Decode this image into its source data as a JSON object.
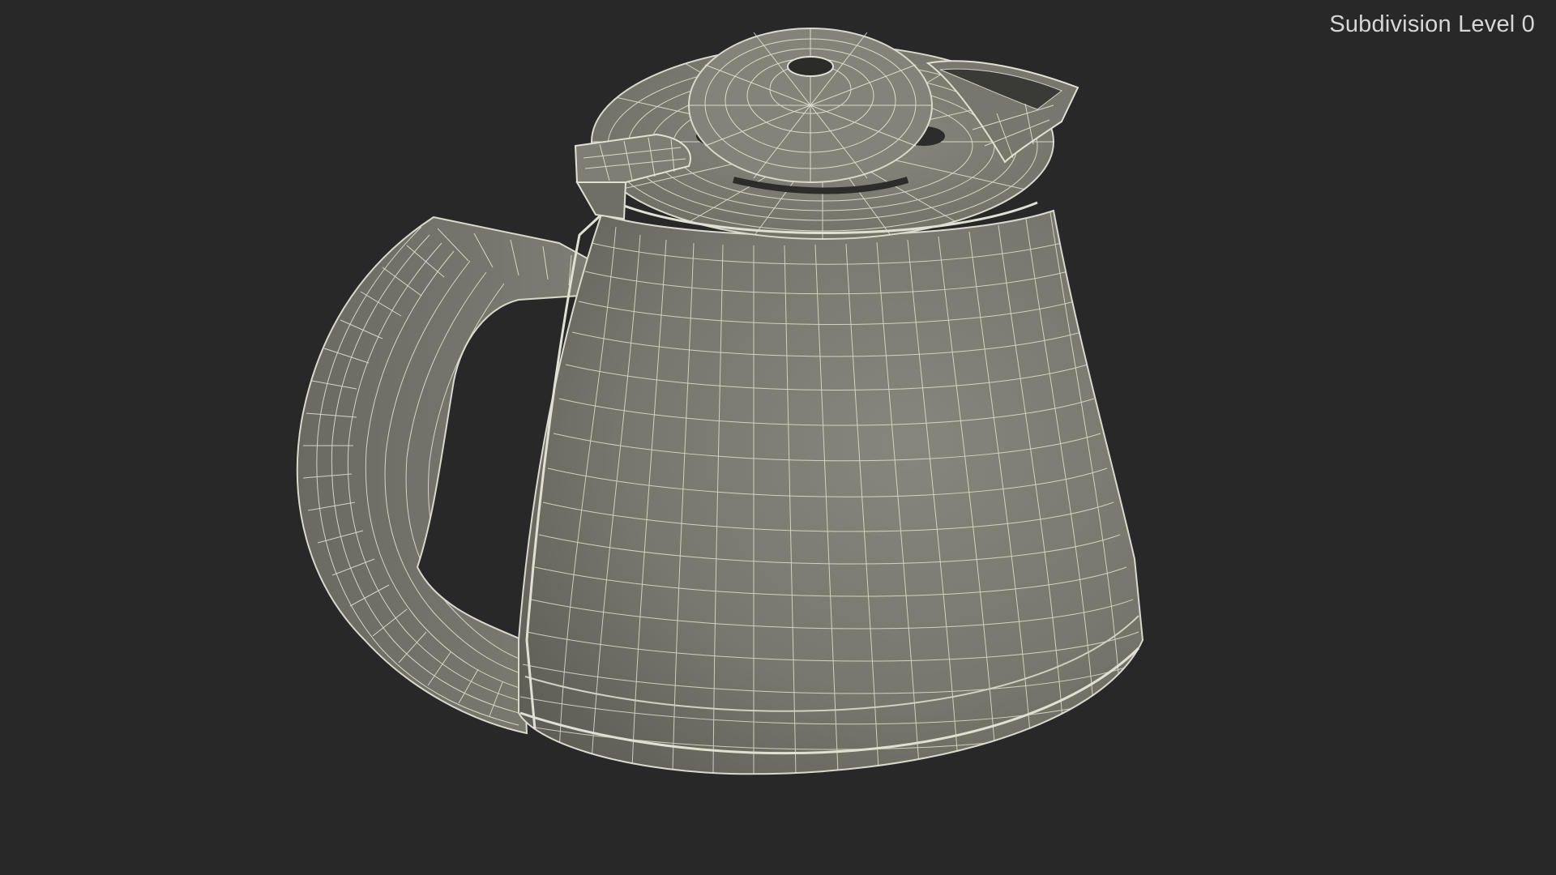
{
  "viewport": {
    "subdivision_label": "Subdivision Level 0",
    "background_color": "#282828"
  },
  "model": {
    "subject": "kettle-wireframe",
    "surface_color": "#7a7a70",
    "wire_color": "#e8e8dc"
  }
}
